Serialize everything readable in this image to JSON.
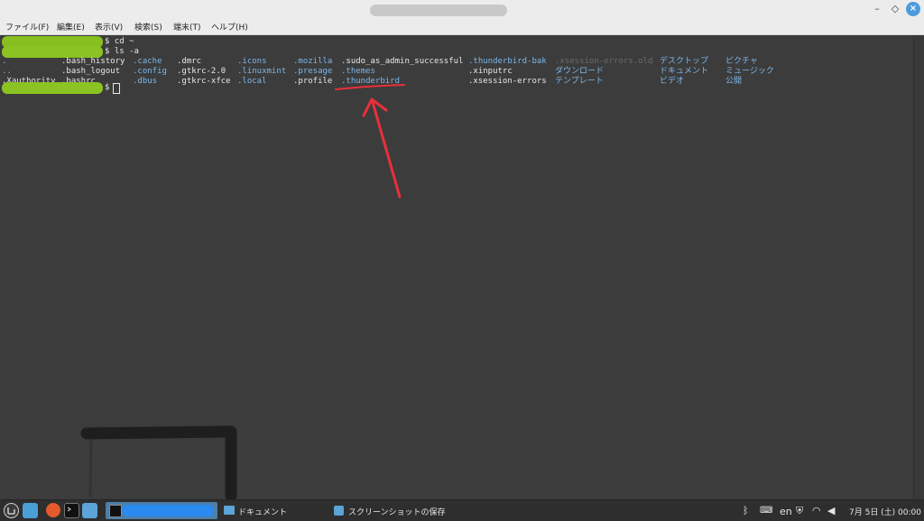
{
  "window": {
    "close_glyph": "×",
    "minimize_glyph": "–",
    "maximize_glyph": "◇"
  },
  "menu": [
    {
      "label": "ファイル(F)"
    },
    {
      "label": "編集(E)"
    },
    {
      "label": "表示(V)"
    },
    {
      "label": "検索(S)"
    },
    {
      "label": "端末(T)"
    },
    {
      "label": "ヘルプ(H)"
    }
  ],
  "terminal": {
    "line1_cmd": "$ cd ~",
    "line2_cmd": "$ ls -a",
    "last_prompt": "$",
    "listing_rows": [
      [
        ".",
        ".bash_history",
        ".cache",
        ".dmrc",
        ".icons",
        ".mozilla",
        ".sudo_as_admin_successful",
        ".thunderbird-bak",
        ".xsession-errors.old",
        "デスクトップ",
        "ピクチャ"
      ],
      [
        "..",
        ".bash_logout",
        ".config",
        ".gtkrc-2.0",
        ".linuxmint",
        ".presage",
        ".themes",
        ".xinputrc",
        "ダウンロード",
        "ドキュメント",
        "ミュージック"
      ],
      [
        ".Xauthority",
        ".bashrc",
        ".dbus",
        ".gtkrc-xfce",
        ".local",
        ".profile",
        ".thunderbird",
        ".xsession-errors",
        "テンプレート",
        "ビデオ",
        "公開"
      ]
    ]
  },
  "taskbar": {
    "documents_label": "ドキュメント",
    "screenshot_label": "スクリーンショットの保存",
    "language": "en",
    "clock": "7月 5日 (土) 00:00"
  },
  "colors": {
    "terminal_bg": "#3c3c3c",
    "directory_blue": "#7cb6e8",
    "redaction_green": "#8ac322",
    "annotation_red": "#e8303a",
    "close_button_blue": "#4d9bdc"
  }
}
